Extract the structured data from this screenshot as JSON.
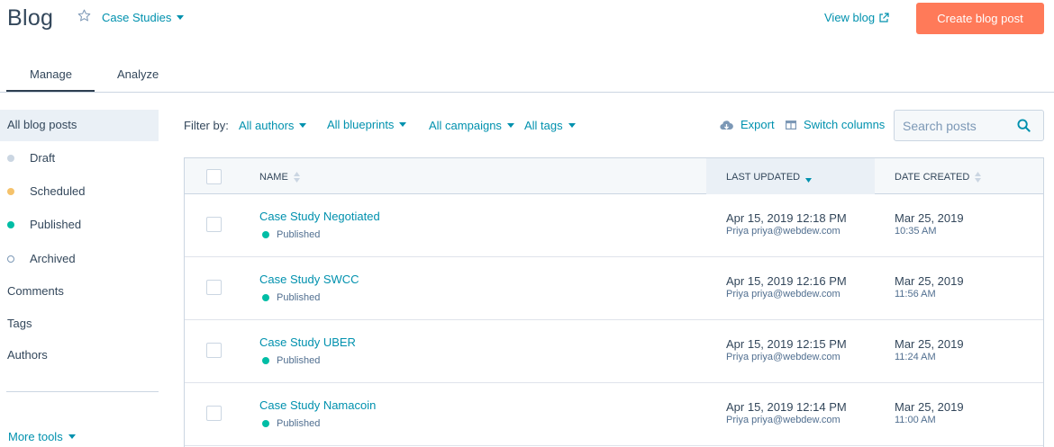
{
  "header": {
    "title": "Blog",
    "blog_selector": "Case Studies",
    "view_blog": "View blog",
    "create_button": "Create blog post"
  },
  "tabs": [
    {
      "label": "Manage",
      "active": true
    },
    {
      "label": "Analyze",
      "active": false
    }
  ],
  "sidebar": {
    "items": [
      {
        "label": "All blog posts",
        "active": true
      },
      {
        "label": "Draft",
        "dot_color": "#cbd6e2"
      },
      {
        "label": "Scheduled",
        "dot_color": "#f5c26b"
      },
      {
        "label": "Published",
        "dot_color": "#00bda5"
      },
      {
        "label": "Archived",
        "dot_color": "hollow"
      },
      {
        "label": "Comments"
      },
      {
        "label": "Tags"
      },
      {
        "label": "Authors"
      }
    ],
    "more_tools": "More tools"
  },
  "filters": {
    "label": "Filter by:",
    "authors": "All authors",
    "blueprints": "All blueprints",
    "campaigns": "All campaigns",
    "tags": "All tags"
  },
  "toolbar": {
    "export": "Export",
    "switch_columns": "Switch columns",
    "search_placeholder": "Search posts"
  },
  "table": {
    "columns": {
      "name": "NAME",
      "last_updated": "LAST UPDATED",
      "date_created": "DATE CREATED"
    },
    "sorted_column": "last_updated",
    "rows": [
      {
        "name": "Case Study Negotiated",
        "status": "Published",
        "updated": "Apr 15, 2019 12:18 PM",
        "updated_by": "Priya priya@webdew.com",
        "created_date": "Mar 25, 2019",
        "created_time": "10:35 AM"
      },
      {
        "name": "Case Study SWCC",
        "status": "Published",
        "updated": "Apr 15, 2019 12:16 PM",
        "updated_by": "Priya priya@webdew.com",
        "created_date": "Mar 25, 2019",
        "created_time": "11:56 AM"
      },
      {
        "name": "Case Study UBER",
        "status": "Published",
        "updated": "Apr 15, 2019 12:15 PM",
        "updated_by": "Priya priya@webdew.com",
        "created_date": "Mar 25, 2019",
        "created_time": "11:24 AM"
      },
      {
        "name": "Case Study Namacoin",
        "status": "Published",
        "updated": "Apr 15, 2019 12:14 PM",
        "updated_by": "Priya priya@webdew.com",
        "created_date": "Mar 25, 2019",
        "created_time": "11:00 AM"
      }
    ]
  },
  "colors": {
    "accent": "#ff7a59",
    "link": "#0091ae",
    "text": "#33475b",
    "published": "#00bda5"
  }
}
